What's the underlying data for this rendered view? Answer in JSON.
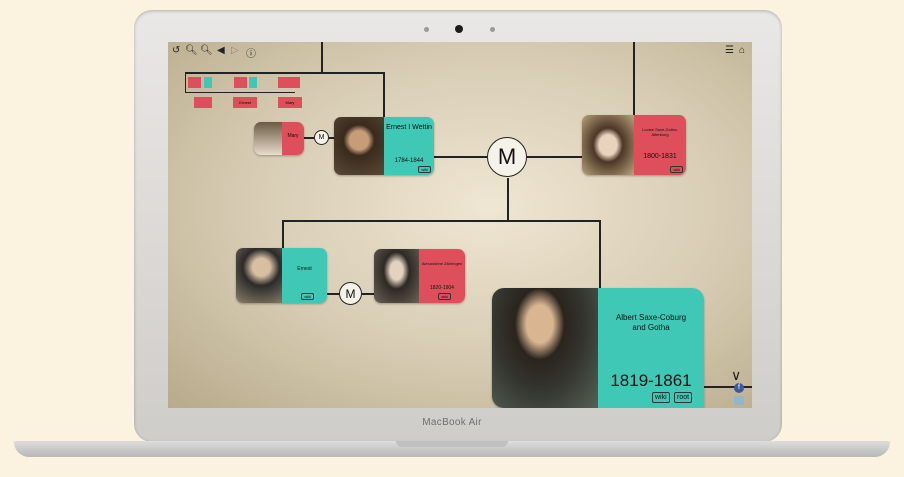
{
  "device": {
    "brand_label": "MacBook Air"
  },
  "toolbar": {
    "back_icon": "back-arrow-icon",
    "zoom_in_icon": "zoom-in-icon",
    "zoom_out_icon": "zoom-out-icon",
    "prev_icon": "triangle-left-icon",
    "next_icon": "triangle-right-icon",
    "info_icon": "info-circle-icon",
    "menu_icon": "list-icon",
    "home_icon": "home-icon"
  },
  "marriage_label": "M",
  "people": {
    "mary": {
      "name": "Mary"
    },
    "ernest": {
      "name": "Ernest I Wettin",
      "years": "1784-1844",
      "tag": "wiki"
    },
    "louise": {
      "name": "Louise Saxe-Gotha-Altenburg",
      "years": "1800-1831",
      "tag": "wiki"
    },
    "ernest2": {
      "name": "Ernest",
      "tag": "wiki"
    },
    "alexandrine": {
      "name": "Alexandrine Zähringen",
      "years": "1820-1904",
      "tag": "wiki"
    },
    "albert": {
      "name": "Albert Saxe-Coburg and Gotha",
      "years": "1819-1861",
      "tag_wiki": "wiki",
      "tag_root": "root"
    }
  },
  "minimap": {
    "labels": [
      "Ernest",
      "Ernest",
      "Mary"
    ]
  },
  "colors": {
    "male": "#3ec8b5",
    "female": "#df4f5b",
    "line": "#222222"
  }
}
